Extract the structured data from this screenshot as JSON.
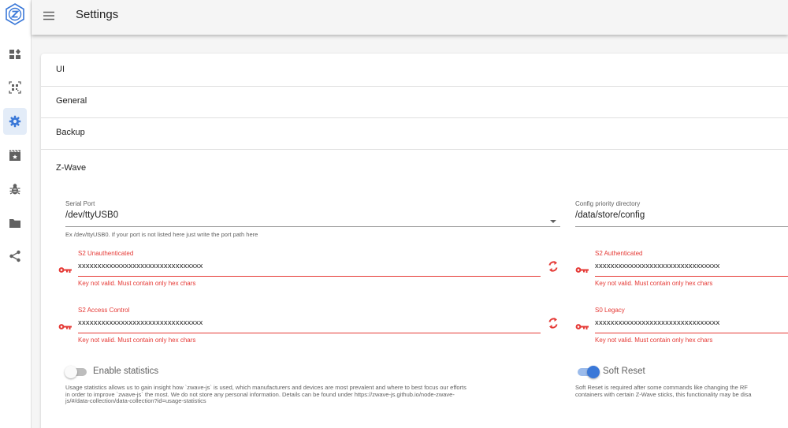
{
  "app": {
    "title": "Settings"
  },
  "sidebar": {
    "items": [
      {
        "name": "dashboard",
        "icon": "dashboard-icon",
        "active": false
      },
      {
        "name": "smart-start",
        "icon": "qr-scan-icon",
        "active": false
      },
      {
        "name": "settings",
        "icon": "gear-icon",
        "active": true
      },
      {
        "name": "scenes",
        "icon": "scene-icon",
        "active": false
      },
      {
        "name": "debug",
        "icon": "bug-icon",
        "active": false
      },
      {
        "name": "store",
        "icon": "folder-icon",
        "active": false
      },
      {
        "name": "network-graph",
        "icon": "share-icon",
        "active": false
      }
    ]
  },
  "panels": [
    "UI",
    "General",
    "Backup",
    "Z-Wave"
  ],
  "zwave": {
    "serial_port": {
      "label": "Serial Port",
      "value": "/dev/ttyUSB0",
      "hint": "Ex /dev/ttyUSB0. If your port is not listed here just write the port path here"
    },
    "config_dir": {
      "label": "Config priority directory",
      "value": "/data/store/config"
    },
    "keys": {
      "s2_unauthenticated": {
        "label": "S2 Unauthenticated",
        "value": "xxxxxxxxxxxxxxxxxxxxxxxxxxxxxxxx",
        "error": "Key not valid. Must contain only hex chars"
      },
      "s2_authenticated": {
        "label": "S2 Authenticated",
        "value": "xxxxxxxxxxxxxxxxxxxxxxxxxxxxxxxx",
        "error": "Key not valid. Must contain only hex chars"
      },
      "s2_access_control": {
        "label": "S2 Access Control",
        "value": "xxxxxxxxxxxxxxxxxxxxxxxxxxxxxxxx",
        "error": "Key not valid. Must contain only hex chars"
      },
      "s0_legacy": {
        "label": "S0 Legacy",
        "value": "xxxxxxxxxxxxxxxxxxxxxxxxxxxxxxxx",
        "error": "Key not valid. Must contain only hex chars"
      }
    },
    "enable_statistics": {
      "label": "Enable statistics",
      "checked": false,
      "description_lines": [
        "Usage statistics allows us to gain insight how `zwave-js` is used, which manufacturers and devices are most prevalent and where to best focus our efforts",
        "in order to improve `zwave-js` the most. We do not store any personal information. Details can be found under https://zwave-js.github.io/node-zwave-",
        "js/#/data-collection/data-collection?id=usage-statistics"
      ]
    },
    "soft_reset": {
      "label": "Soft Reset",
      "checked": true,
      "description_lines": [
        "Soft Reset is required after some commands like changing the RF",
        "containers with certain Z-Wave sticks, this functionality may be disa"
      ]
    }
  },
  "colors": {
    "primary": "#3a78d8",
    "error": "#e53935",
    "icon": "#616161"
  }
}
